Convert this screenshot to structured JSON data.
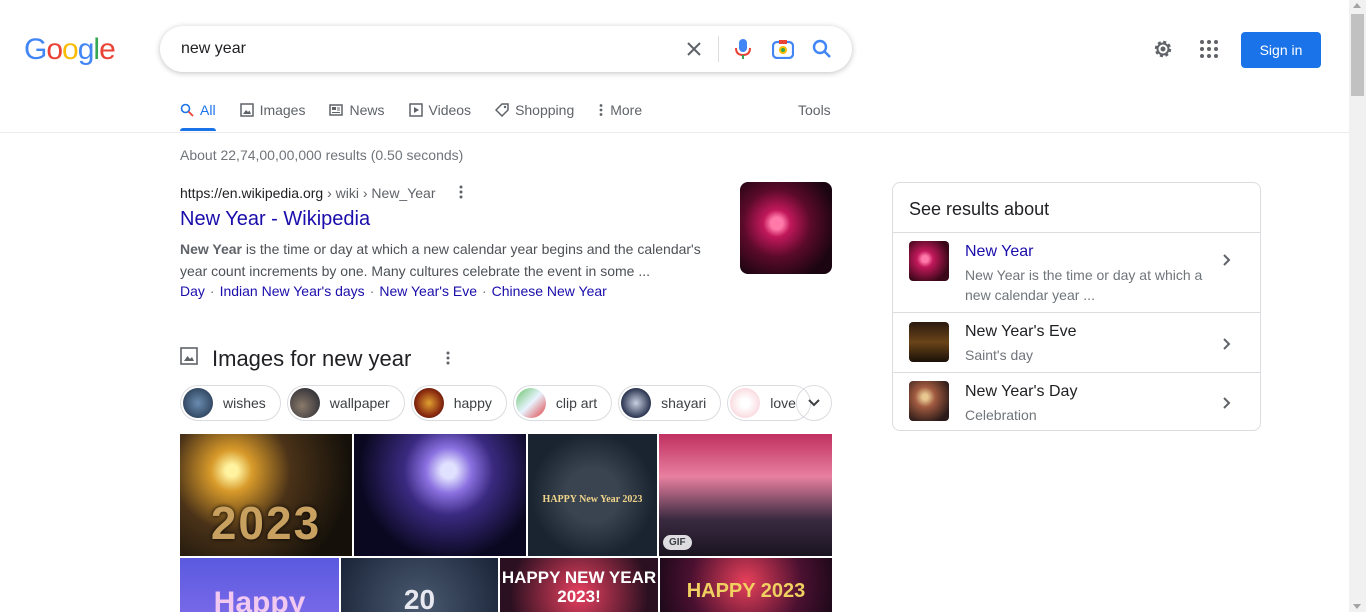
{
  "logo": "Google",
  "search": {
    "query": "new year"
  },
  "header": {
    "signin_label": "Sign in"
  },
  "tabs": [
    {
      "label": "All",
      "icon": "search-icon"
    },
    {
      "label": "Images",
      "icon": "image-icon"
    },
    {
      "label": "News",
      "icon": "news-icon"
    },
    {
      "label": "Videos",
      "icon": "play-icon"
    },
    {
      "label": "Shopping",
      "icon": "tag-icon"
    },
    {
      "label": "More",
      "icon": "more-vert-icon"
    }
  ],
  "tools_label": "Tools",
  "stats": "About 22,74,00,00,000 results (0.50 seconds)",
  "result": {
    "url_domain": "https://en.wikipedia.org",
    "url_crumb": " › wiki › New_Year",
    "title": "New Year - Wikipedia",
    "snippet_bold": "New Year",
    "snippet_rest": " is the time or day at which a new calendar year begins and the calendar's year count increments by one. Many cultures celebrate the event in some ...",
    "sitelinks": [
      "Day",
      "Indian New Year's days",
      "New Year's Eve",
      "Chinese New Year"
    ]
  },
  "images_section": {
    "heading": "Images for new year",
    "chips": [
      "wishes",
      "wallpaper",
      "happy",
      "clip art",
      "shayari",
      "love"
    ],
    "tiles": [
      {
        "text": "2023"
      },
      {
        "text": ""
      },
      {
        "text": "HAPPY New Year 2023"
      },
      {
        "text": "",
        "badge": "GIF"
      },
      {
        "text": "Happy"
      },
      {
        "text": "20"
      },
      {
        "text": "HAPPY NEW YEAR 2023!"
      },
      {
        "text": "HAPPY 2023"
      }
    ]
  },
  "knowledge_panel": {
    "title": "See results about",
    "items": [
      {
        "name": "New Year",
        "desc": "New Year is the time or day at which a new calendar year ..."
      },
      {
        "name": "New Year's Eve",
        "desc": "Saint's day"
      },
      {
        "name": "New Year's Day",
        "desc": "Celebration"
      }
    ]
  }
}
